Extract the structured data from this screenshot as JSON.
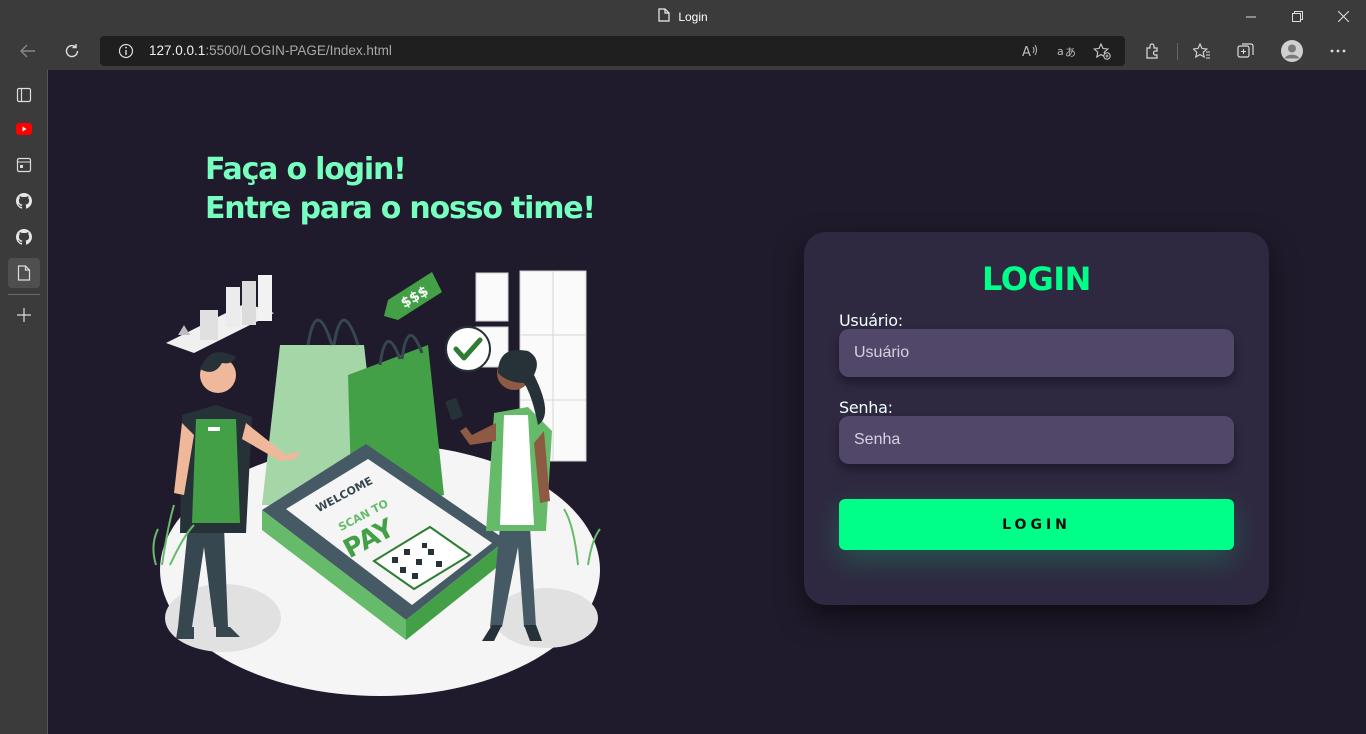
{
  "window": {
    "title": "Login"
  },
  "toolbar": {
    "url_host": "127.0.0.1",
    "url_rest": ":5500/LOGIN-PAGE/Index.html"
  },
  "page": {
    "heading_line1": "Faça o login!",
    "heading_line2": "Entre para o nosso time!",
    "illustration": {
      "price_tag": "$$$",
      "terminal_line1": "WELCOME",
      "terminal_line2": "SCAN TO",
      "terminal_line3": "PAY"
    }
  },
  "login": {
    "title": "LOGIN",
    "user_label": "Usuário:",
    "user_placeholder": "Usuário",
    "password_label": "Senha:",
    "password_placeholder": "Senha",
    "button": "LOGIN"
  },
  "colors": {
    "accent": "#00ff88",
    "heading": "#77ffc0",
    "card": "#2f2841",
    "input": "#514869",
    "background": "#201b2c"
  }
}
